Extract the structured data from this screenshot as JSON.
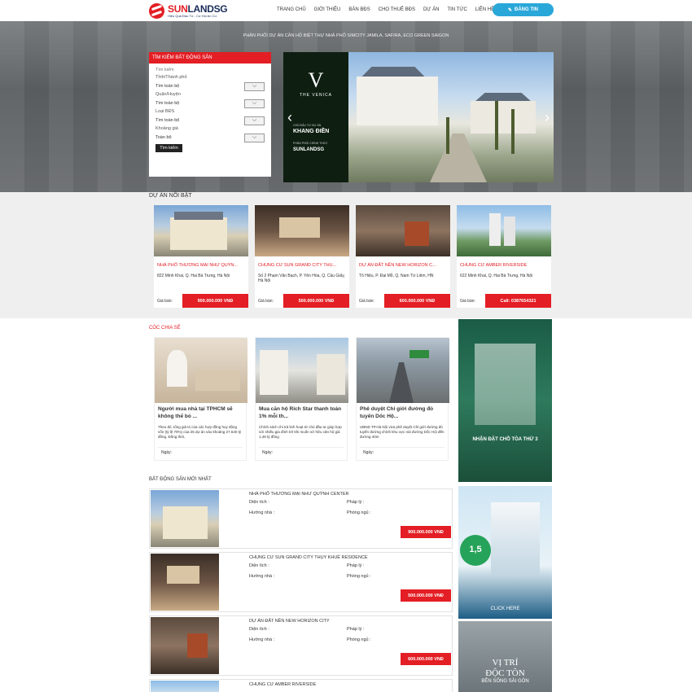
{
  "brand": {
    "name_red": "SUN",
    "name_dark": "LANDSG",
    "slogan": "Hiệu Quả Đầu Tư - Cơ Hội An Cư"
  },
  "nav": [
    "TRANG CHỦ",
    "GIỚI THIỆU",
    "BÁN BĐS",
    "CHO THUÊ BĐS",
    "DỰ ÁN",
    "TIN TỨC",
    "LIÊN HỆ"
  ],
  "register_label": "ĐĂNG TIN",
  "hero": {
    "tagline": "PHÂN PHỐI DỰ ÁN CĂN HỘ BIỆT THỰ NHÀ PHỐ SIMCITY JAMILA, SAFIRA, ECO GREEN SAIGON"
  },
  "search": {
    "title": "TÌM KIẾM BẤT ĐỘNG SẢN",
    "keyword_placeholder": "Tìm kiếm",
    "city_label": "Tỉnh/Thành phố",
    "city_value": "Tìm toàn bộ",
    "district_label": "Quận/Huyện",
    "district_value": "Tìm toàn bộ",
    "type_label": "Loại BĐS",
    "type_value": "Tìm toàn bộ",
    "price_label": "Khoảng giá",
    "price_value": "Toàn bộ",
    "button": "Tìm kiếm"
  },
  "slider": {
    "letter": "V",
    "project": "THE VENICA",
    "dev_label": "CHỦ ĐẦU TƯ DỰ ÁN",
    "developer": "KHANG ĐIỀN",
    "dist_label": "PHÂN PHỐI CHÍNH THỨC",
    "distributor": "SUNLANDSG"
  },
  "featured": {
    "title": "DỰ ÁN NỔI BẬT",
    "price_label": "Giá bán:",
    "items": [
      {
        "title": "NHÀ PHỐ THƯƠNG MẠI NHƯ QUỲN...",
        "address": "822 Minh Khai, Q. Hai Bà Trưng, Hà Nội",
        "price": "900.000.000 VNĐ"
      },
      {
        "title": "CHUNG CƯ SUN GRAND CITY THU...",
        "address": "Số 2 Phạm Văn Bạch, P. Yên Hòa, Q. Cầu Giấy, Hà Nội",
        "price": "500.000.000 VNĐ"
      },
      {
        "title": "DỰ ÁN ĐẤT NỀN NEW HORIZON C...",
        "address": "Tô Hiệu, P. Đại Mỗ, Q. Nam Từ Liêm, HN",
        "price": "600.000.000 VNĐ"
      },
      {
        "title": "CHUNG CƯ AMBER RIVERSIDE",
        "address": "622 Minh Khai, Q. Hai Bà Trưng, Hà Nội",
        "price": "Call: 0387654321"
      }
    ]
  },
  "share": {
    "title": "CÓC CHIA SẺ",
    "date_label": "Ngày:",
    "items": [
      {
        "title": "Người mua nhà tại TPHCM sẽ không thể bỏ ...",
        "desc": "Theo đó, tổng giá trị của các hợp đồng huy động vốn (tỷ lệ 70%) của 25 dự án vào khoảng 27.540 tỷ đồng. Đồng thời,"
      },
      {
        "title": "Mua căn hộ Rich Star thanh toán 1% mỗi th...",
        "desc": "Chính sách chi trả linh hoạt từ chủ đầu tư giúp hợp với nhiều gia đình trẻ khi muốn sở hữu căn hộ giá 1,49 tỷ đồng"
      },
      {
        "title": "Phê duyệt Chỉ giới đường đỏ tuyến Dốc Hộ...",
        "desc": "UBND TP.Hà Nội vừa phê duyệt Chỉ giới đường đỏ tuyến đường chính khu vực nút đường Dốc Hội đến đường 40m"
      }
    ]
  },
  "ads": {
    "ad1_headline": "NHẬN ĐẶT CHỖ TÒA THỨ 3",
    "ad2_number": "1,5",
    "ad2_cta": "CLICK HERE",
    "ad3_line1": "VỊ TRÍ",
    "ad3_line2": "ĐỘC TÔN",
    "ad3_line3": "BÊN SÔNG SÀI GÒN"
  },
  "newest": {
    "title": "BẤT ĐỘNG SẢN MỚI NHẤT",
    "area_label": "Diện tích :",
    "legal_label": "Pháp lý :",
    "direction_label": "Hướng nhà :",
    "room_label": "Phòng ngủ :",
    "items": [
      {
        "title": "NHÀ PHỐ THƯƠNG MẠI NHƯ QUỲNH CENTER",
        "price": "900.000.000 VNĐ"
      },
      {
        "title": "CHUNG CƯ SUN GRAND CITY THỤY KHUÊ RESIDENCE",
        "price": "500.000.000 VNĐ"
      },
      {
        "title": "DỰ ÁN ĐẤT NỀN NEW HORIZON CITY",
        "price": "600.000.000 VNĐ"
      },
      {
        "title": "CHUNG CƯ AMBER RIVERSIDE",
        "price": ""
      }
    ]
  },
  "colors": {
    "accent": "#e31e24",
    "cta": "#2aa7d9"
  }
}
